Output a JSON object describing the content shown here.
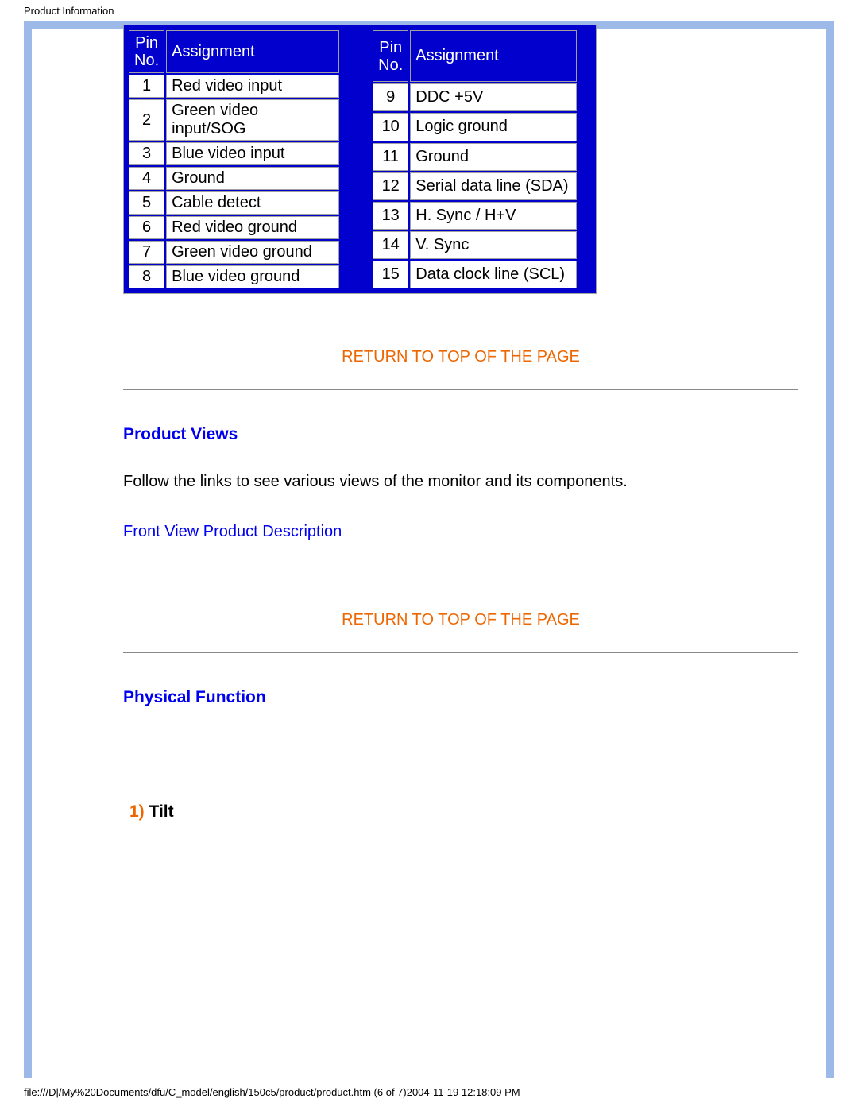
{
  "page_header": "Product Information",
  "pin_table": {
    "header_pin": "Pin\nNo.",
    "header_assign": "Assignment",
    "left": [
      {
        "no": "1",
        "assign": "Red video input"
      },
      {
        "no": "2",
        "assign": "Green video input/SOG"
      },
      {
        "no": "3",
        "assign": "Blue video input"
      },
      {
        "no": "4",
        "assign": "Ground"
      },
      {
        "no": "5",
        "assign": "Cable detect"
      },
      {
        "no": "6",
        "assign": "Red video ground"
      },
      {
        "no": "7",
        "assign": "Green video ground"
      },
      {
        "no": "8",
        "assign": "Blue video ground"
      }
    ],
    "right": [
      {
        "no": "9",
        "assign": "DDC +5V"
      },
      {
        "no": "10",
        "assign": "Logic ground"
      },
      {
        "no": "11",
        "assign": "Ground"
      },
      {
        "no": "12",
        "assign": "Serial data line (SDA)"
      },
      {
        "no": "13",
        "assign": "H. Sync / H+V"
      },
      {
        "no": "14",
        "assign": "V. Sync"
      },
      {
        "no": "15",
        "assign": "Data clock line (SCL)"
      }
    ]
  },
  "links": {
    "return_top": "RETURN TO TOP OF THE PAGE",
    "front_view": "Front View Product Description"
  },
  "sections": {
    "product_views": "Product Views",
    "product_views_text": "Follow the links to see various views of the monitor and its components.",
    "physical_function": "Physical Function",
    "tilt_num": "1)",
    "tilt_label": " Tilt"
  },
  "footer": "file:///D|/My%20Documents/dfu/C_model/english/150c5/product/product.htm (6 of 7)2004-11-19 12:18:09 PM"
}
